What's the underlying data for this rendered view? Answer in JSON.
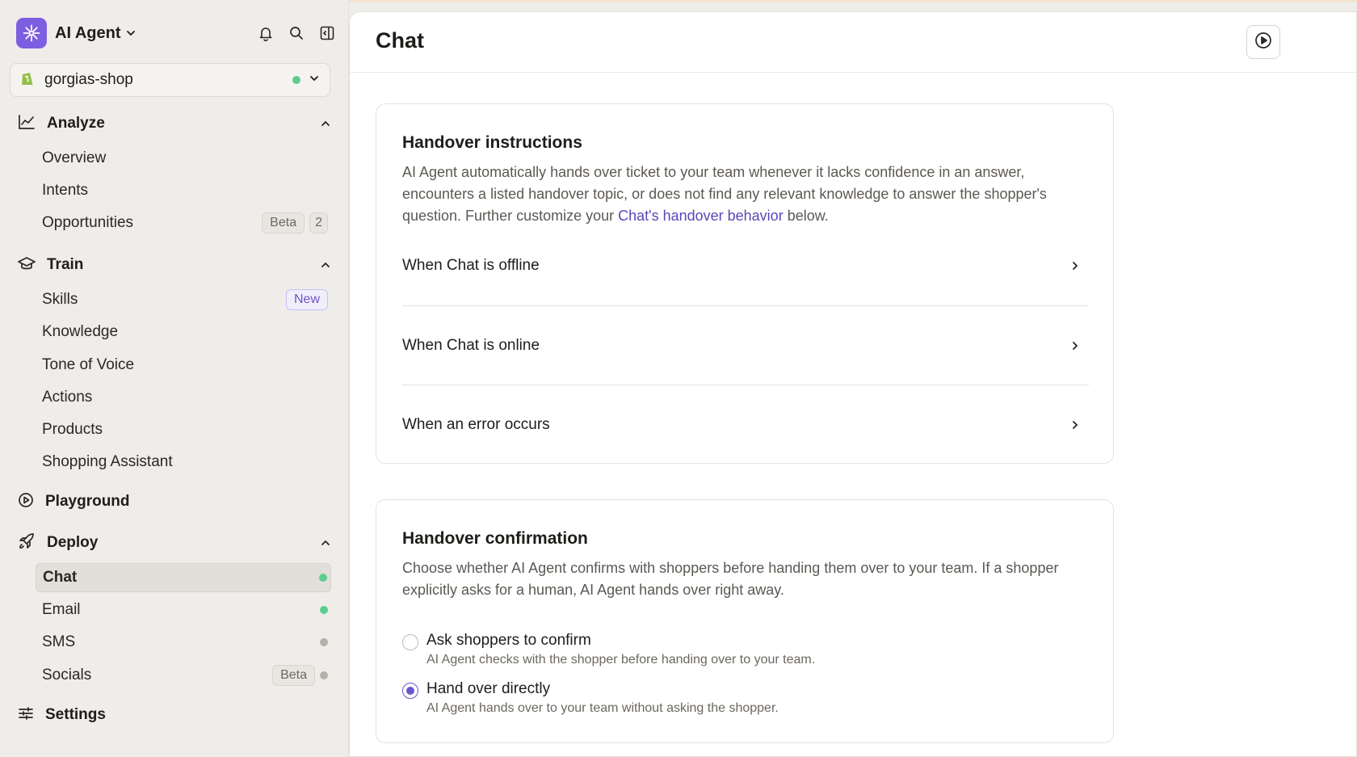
{
  "app": {
    "name": "AI Agent",
    "store": "gorgias-shop"
  },
  "nav": {
    "analyze": {
      "label": "Analyze",
      "items": [
        {
          "label": "Overview"
        },
        {
          "label": "Intents"
        },
        {
          "label": "Opportunities",
          "badge": "Beta",
          "count": "2"
        }
      ]
    },
    "train": {
      "label": "Train",
      "items": [
        {
          "label": "Skills",
          "badge": "New"
        },
        {
          "label": "Knowledge"
        },
        {
          "label": "Tone of Voice"
        },
        {
          "label": "Actions"
        },
        {
          "label": "Products"
        },
        {
          "label": "Shopping Assistant"
        }
      ]
    },
    "playground": {
      "label": "Playground"
    },
    "deploy": {
      "label": "Deploy",
      "items": [
        {
          "label": "Chat",
          "status": "active"
        },
        {
          "label": "Email",
          "status": "active"
        },
        {
          "label": "SMS",
          "status": "inactive"
        },
        {
          "label": "Socials",
          "badge": "Beta",
          "status": "inactive"
        }
      ]
    },
    "settings": {
      "label": "Settings"
    }
  },
  "main": {
    "title": "Chat",
    "handover_instructions": {
      "title": "Handover instructions",
      "desc_before": "AI Agent automatically hands over ticket to your team whenever it lacks confidence in an answer, encounters a listed handover topic, or does not find any relevant knowledge to answer the shopper's question. Further customize your ",
      "link": "Chat's handover behavior",
      "desc_after": " below.",
      "rows": [
        {
          "label": "When Chat is offline"
        },
        {
          "label": "When Chat is online"
        },
        {
          "label": "When an error occurs"
        }
      ]
    },
    "handover_confirmation": {
      "title": "Handover confirmation",
      "desc": "Choose whether AI Agent confirms with shoppers before handing them over to your team. If a shopper explicitly asks for a human, AI Agent hands over right away.",
      "options": [
        {
          "label": "Ask shoppers to confirm",
          "sub": "AI Agent checks with the shopper before handing over to your team.",
          "selected": false
        },
        {
          "label": "Hand over directly",
          "sub": "AI Agent hands over to your team without asking the shopper.",
          "selected": true
        }
      ]
    }
  },
  "colors": {
    "accent": "#6c55c9",
    "logo": "#7b5fe0",
    "status_green": "#5ccd8f",
    "status_grey": "#b3afa9"
  }
}
